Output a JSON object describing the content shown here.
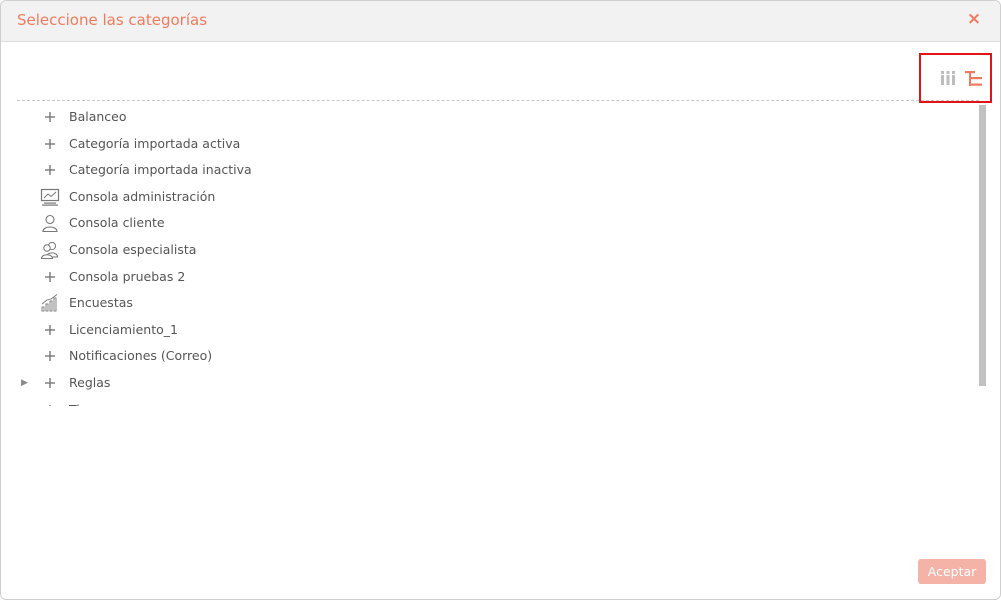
{
  "dialog": {
    "title": "Seleccione las categorías",
    "close_symbol": "×"
  },
  "toolbar": {
    "columns_view_icon": "columns-view-icon",
    "tree_view_icon": "tree-view-icon",
    "active_view": "tree",
    "highlight_color": "#e01414"
  },
  "tree": {
    "items": [
      {
        "label": "Balanceo",
        "icon": "plus-icon",
        "expandable": false
      },
      {
        "label": "Categoría importada activa",
        "icon": "plus-icon",
        "expandable": false
      },
      {
        "label": "Categoría importada inactiva",
        "icon": "plus-icon",
        "expandable": false
      },
      {
        "label": "Consola administración",
        "icon": "monitor-icon",
        "expandable": false
      },
      {
        "label": "Consola cliente",
        "icon": "user-icon",
        "expandable": false
      },
      {
        "label": "Consola especialista",
        "icon": "users-icon",
        "expandable": false
      },
      {
        "label": "Consola pruebas 2",
        "icon": "plus-icon",
        "expandable": false
      },
      {
        "label": "Encuestas",
        "icon": "bar-chart-icon",
        "expandable": false
      },
      {
        "label": "Licenciamiento_1",
        "icon": "plus-icon",
        "expandable": false
      },
      {
        "label": "Notificaciones (Correo)",
        "icon": "plus-icon",
        "expandable": false
      },
      {
        "label": "Reglas",
        "icon": "plus-icon",
        "expandable": true
      },
      {
        "label": "Ti",
        "icon": "plus-icon",
        "expandable": false
      }
    ]
  },
  "footer": {
    "accept_label": "Aceptar"
  },
  "colors": {
    "accent": "#ef7b5e",
    "accept_bg": "#f5b3a7",
    "text": "#555555"
  }
}
